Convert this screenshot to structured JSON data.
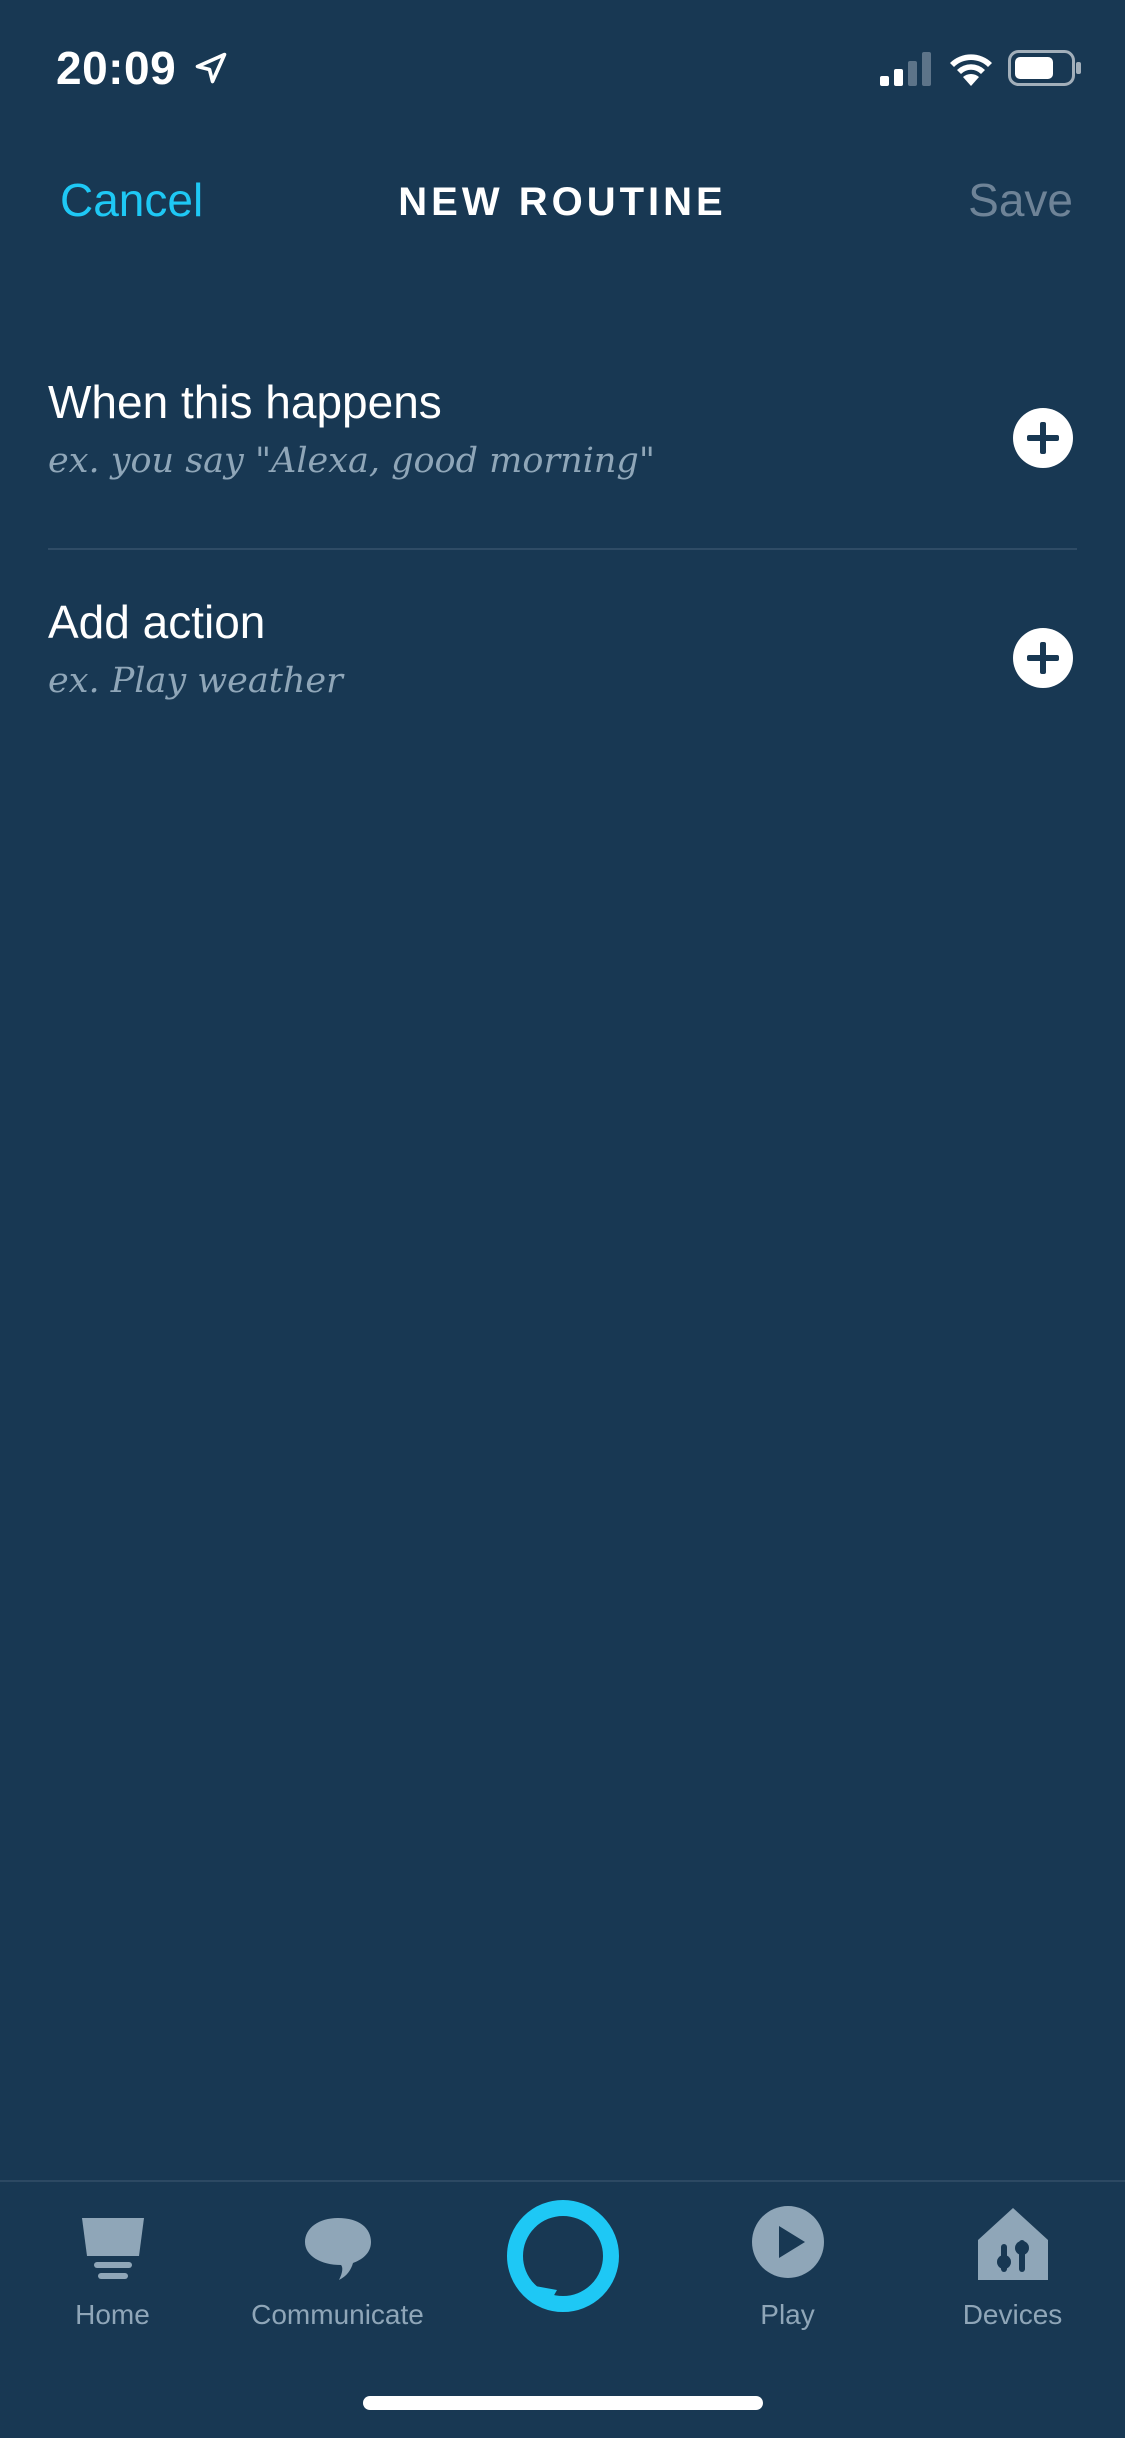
{
  "status_bar": {
    "time": "20:09"
  },
  "header": {
    "cancel_label": "Cancel",
    "title": "NEW ROUTINE",
    "save_label": "Save"
  },
  "rows": [
    {
      "title": "When this happens",
      "hint": "ex. you say \"Alexa, good morning\""
    },
    {
      "title": "Add action",
      "hint": "ex. Play weather"
    }
  ],
  "tabs": [
    {
      "label": "Home",
      "icon": "home-icon"
    },
    {
      "label": "Communicate",
      "icon": "chat-bubble-icon"
    },
    {
      "label": "",
      "icon": "alexa-ring-icon"
    },
    {
      "label": "Play",
      "icon": "play-icon"
    },
    {
      "label": "Devices",
      "icon": "devices-icon"
    }
  ],
  "colors": {
    "background": "#183853",
    "accent": "#1ec8f5",
    "muted": "#6e8397",
    "hint": "#8fa6b8"
  }
}
